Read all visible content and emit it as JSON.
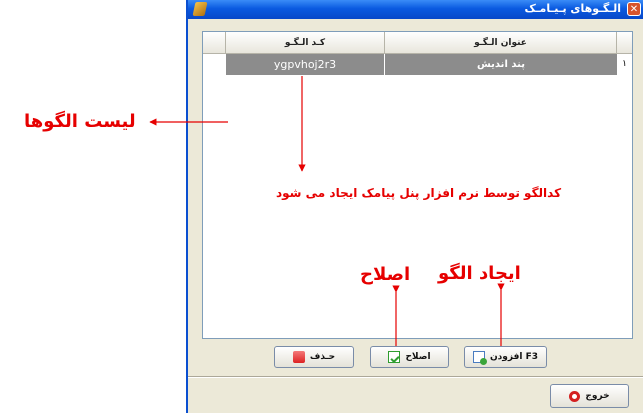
{
  "window": {
    "title": "الـگـوهای پـیـامـک",
    "close_glyph": "✕"
  },
  "grid": {
    "columns": {
      "num": "",
      "title": "عنوان الـگـو",
      "code": "کـد الـگـو"
    },
    "rows": [
      {
        "num": "۱",
        "title": "پند اندیش",
        "code": "ygpvhoj2r3"
      }
    ]
  },
  "buttons": {
    "add": "افزودن F3",
    "edit": "اصلاح",
    "delete": "حـذف",
    "exit": "خروج"
  },
  "annotations": {
    "list": "لیست الگوها",
    "code_note": "کدالگو توسط نرم افزار پنل پیامک ایجاد می شود",
    "add": "ایجاد الگو",
    "edit": "اصلاح"
  },
  "colors": {
    "annotation": "#e60000",
    "title_bar": "#0a5ae0",
    "selected_row": "#8c8c8c"
  },
  "icons": {
    "app": "app-icon",
    "close": "close-icon",
    "delete": "trash-icon",
    "edit": "edit-icon",
    "add": "add-document-icon",
    "exit": "exit-icon"
  }
}
